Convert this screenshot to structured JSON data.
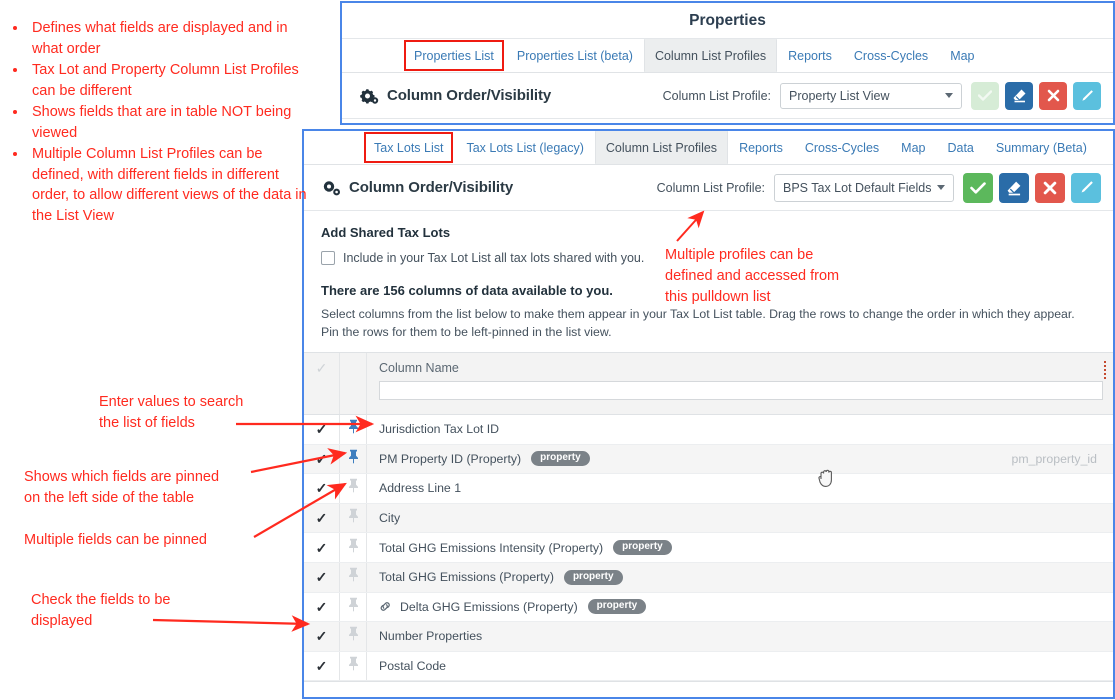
{
  "annotations": {
    "bullets": [
      "Defines what fields are displayed and in what order",
      "Tax Lot and Property Column List Profiles can be different",
      "Shows fields that are in table NOT being viewed",
      "Multiple Column List Profiles can be defined, with different fields in different order, to allow different views of the data in the List View"
    ],
    "profiles_note": "Multiple profiles can be\ndefined and accessed from\nthis pulldown list",
    "search_note": "Enter values to search\nthe list of fields",
    "pinned_note": "Shows which fields are pinned\non the left side of the table",
    "multi_pin_note": "Multiple fields can be pinned",
    "check_note": "Check the fields to be\ndisplayed",
    "color": "#ff2a1f"
  },
  "properties_window": {
    "title": "Properties",
    "tabs": [
      {
        "label": "Properties List",
        "state": "highlighted"
      },
      {
        "label": "Properties List (beta)",
        "state": "normal"
      },
      {
        "label": "Column List Profiles",
        "state": "active"
      },
      {
        "label": "Reports",
        "state": "normal"
      },
      {
        "label": "Cross-Cycles",
        "state": "normal"
      },
      {
        "label": "Map",
        "state": "normal"
      }
    ],
    "toolbar": {
      "heading": "Column Order/Visibility",
      "profile_label": "Column List Profile:",
      "profile_value": "Property List View",
      "buttons": [
        {
          "name": "save-button",
          "icon": "check-icon",
          "color": "#d6ecd6",
          "disabled": true
        },
        {
          "name": "clear-button",
          "icon": "eraser-icon",
          "color": "#2a6ca8",
          "disabled": false
        },
        {
          "name": "delete-button",
          "icon": "close-icon",
          "color": "#e2574c",
          "disabled": false
        },
        {
          "name": "edit-button",
          "icon": "pencil-icon",
          "color": "#5bc0de",
          "disabled": false
        }
      ]
    }
  },
  "taxlots_window": {
    "tabs": [
      {
        "label": "Tax Lots List",
        "state": "highlighted"
      },
      {
        "label": "Tax Lots List (legacy)",
        "state": "normal"
      },
      {
        "label": "Column List Profiles",
        "state": "active"
      },
      {
        "label": "Reports",
        "state": "normal"
      },
      {
        "label": "Cross-Cycles",
        "state": "normal"
      },
      {
        "label": "Map",
        "state": "normal"
      },
      {
        "label": "Data",
        "state": "normal"
      },
      {
        "label": "Summary (Beta)",
        "state": "normal"
      }
    ],
    "toolbar": {
      "heading": "Column Order/Visibility",
      "profile_label": "Column List Profile:",
      "profile_value": "BPS Tax Lot Default Fields",
      "buttons": [
        {
          "name": "save-button",
          "icon": "check-icon",
          "color": "#5cb85c",
          "disabled": false
        },
        {
          "name": "clear-button",
          "icon": "eraser-icon",
          "color": "#2a6ca8",
          "disabled": false
        },
        {
          "name": "delete-button",
          "icon": "close-icon",
          "color": "#e2574c",
          "disabled": false
        },
        {
          "name": "edit-button",
          "icon": "pencil-icon",
          "color": "#5bc0de",
          "disabled": false
        }
      ]
    },
    "shared": {
      "title": "Add Shared Tax Lots",
      "checkbox_label": "Include in your Tax Lot List all tax lots shared with you.",
      "checked": false
    },
    "availability": "There are 156 columns of data available to you.",
    "help_text": "Select columns from the list below to make them appear in your Tax Lot List table. Drag the rows to change the order in which they appear. Pin the rows for them to be left-pinned in the list view.",
    "grid": {
      "header": {
        "column_name_label": "Column Name",
        "filter_value": "",
        "filter_placeholder": ""
      },
      "rows": [
        {
          "name": "Jurisdiction Tax Lot ID",
          "checked": true,
          "pinned": true,
          "badge": "",
          "linked": false,
          "field_key": ""
        },
        {
          "name": "PM Property ID (Property)",
          "checked": true,
          "pinned": true,
          "badge": "property",
          "linked": false,
          "field_key": "pm_property_id"
        },
        {
          "name": "Address Line 1",
          "checked": true,
          "pinned": false,
          "badge": "",
          "linked": false,
          "field_key": ""
        },
        {
          "name": "City",
          "checked": true,
          "pinned": false,
          "badge": "",
          "linked": false,
          "field_key": ""
        },
        {
          "name": "Total GHG Emissions Intensity (Property)",
          "checked": true,
          "pinned": false,
          "badge": "property",
          "linked": false,
          "field_key": ""
        },
        {
          "name": "Total GHG Emissions (Property)",
          "checked": true,
          "pinned": false,
          "badge": "property",
          "linked": false,
          "field_key": ""
        },
        {
          "name": "Delta GHG Emissions (Property)",
          "checked": true,
          "pinned": false,
          "badge": "property",
          "linked": true,
          "field_key": ""
        },
        {
          "name": "Number Properties",
          "checked": true,
          "pinned": false,
          "badge": "",
          "linked": false,
          "field_key": ""
        },
        {
          "name": "Postal Code",
          "checked": true,
          "pinned": false,
          "badge": "",
          "linked": false,
          "field_key": ""
        }
      ]
    }
  }
}
